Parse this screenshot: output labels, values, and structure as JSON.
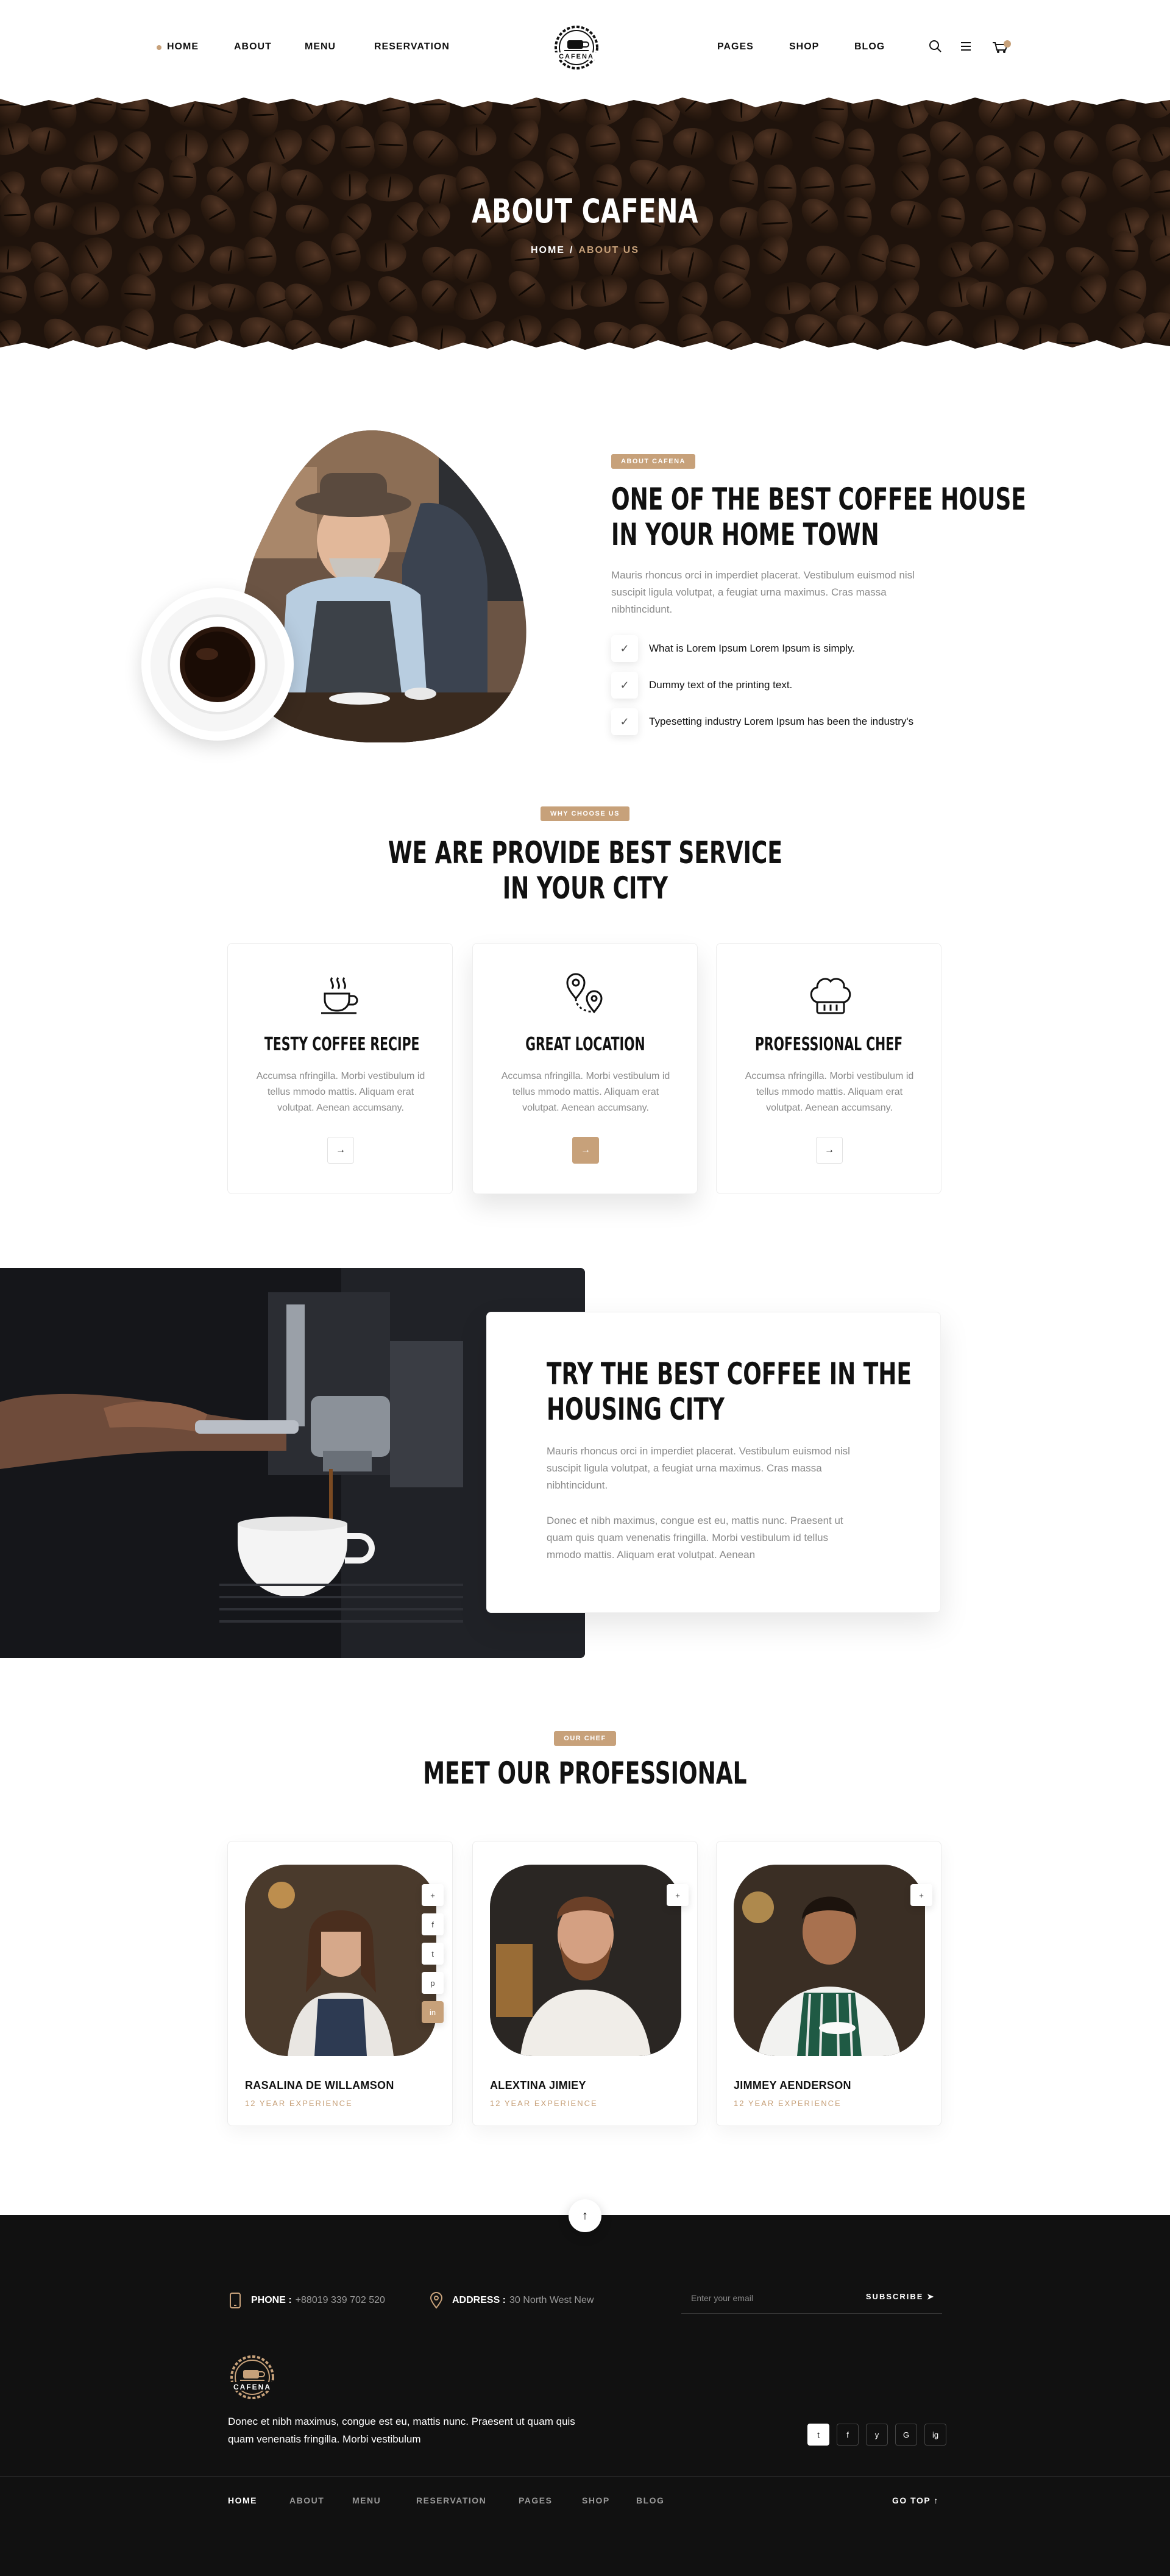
{
  "nav": {
    "left": [
      "HOME",
      "ABOUT",
      "MENU",
      "RESERVATION"
    ],
    "right": [
      "PAGES",
      "SHOP",
      "BLOG"
    ],
    "logo_text": "CAFENA",
    "cart_count": "0",
    "accent": "#c7a17a"
  },
  "hero": {
    "title": "ABOUT CAFENA",
    "crumb_home": "HOME",
    "crumb_sep": "/",
    "crumb_current": "ABOUT US"
  },
  "about": {
    "tag": "ABOUT CAFENA",
    "heading_line1": "ONE OF THE BEST COFFEE HOUSE",
    "heading_line2": "IN YOUR HOME TOWN",
    "paragraph": "Mauris rhoncus orci in imperdiet placerat. Vestibulum euismod nisl suscipit ligula volutpat, a feugiat urna maximus. Cras massa nibhtincidunt.",
    "checks": [
      "What is Lorem Ipsum Lorem Ipsum is simply.",
      "Dummy text of the printing text.",
      "Typesetting industry Lorem Ipsum has been the industry's"
    ]
  },
  "services": {
    "tag": "WHY CHOOSE US",
    "heading_line1": "WE ARE PROVIDE BEST SERVICE",
    "heading_line2": "IN YOUR CITY",
    "cards": [
      {
        "title": "TESTY COFFEE RECIPE",
        "desc": "Accumsa nfringilla. Morbi vestibulum id tellus mmodo mattis. Aliquam erat volutpat. Aenean accumsany.",
        "icon": "coffee-cup-icon",
        "arrow": "→"
      },
      {
        "title": "GREAT LOCATION",
        "desc": "Accumsa nfringilla. Morbi vestibulum id tellus mmodo mattis. Aliquam erat volutpat. Aenean accumsany.",
        "icon": "map-pin-icon",
        "arrow": "→"
      },
      {
        "title": "PROFESSIONAL CHEF",
        "desc": "Accumsa nfringilla. Morbi vestibulum id tellus mmodo mattis. Aliquam erat volutpat. Aenean accumsany.",
        "icon": "chef-hat-icon",
        "arrow": "→"
      }
    ]
  },
  "try": {
    "heading_line1": "TRY THE BEST COFFEE IN THE",
    "heading_line2": "HOUSING CITY",
    "paragraph1": "Mauris rhoncus orci in imperdiet placerat. Vestibulum euismod nisl suscipit ligula volutpat, a feugiat urna maximus. Cras massa nibhtincidunt.",
    "paragraph2": "Donec et nibh maximus, congue est eu, mattis nunc. Praesent ut quam quis quam venenatis fringilla. Morbi vestibulum id tellus mmodo mattis. Aliquam erat volutpat. Aenean"
  },
  "chefs": {
    "tag": "OUR CHEF",
    "heading": "MEET OUR PROFESSIONAL",
    "members": [
      {
        "name": "RASALINA DE WILLAMSON",
        "exp": "12 YEAR EXPERIENCE"
      },
      {
        "name": "ALEXTINA JIMIEY",
        "exp": "12 YEAR EXPERIENCE"
      },
      {
        "name": "JIMMEY AENDERSON",
        "exp": "12 YEAR EXPERIENCE"
      }
    ],
    "share_icons": [
      "+",
      "f",
      "t",
      "p",
      "in"
    ]
  },
  "footer": {
    "phone_label": "PHONE :",
    "phone_value": "+88019 339 702 520",
    "address_label": "ADDRESS :",
    "address_value": "30 North West New",
    "email_placeholder": "Enter your email",
    "subscribe": "SUBSCRIBE",
    "logo_text": "CAFENA",
    "text": "Donec et nibh maximus, congue est eu, mattis nunc. Praesent ut quam quis quam venenatis fringilla. Morbi vestibulum",
    "social": [
      "t",
      "f",
      "y",
      "G",
      "ig"
    ],
    "nav": [
      "HOME",
      "ABOUT",
      "MENU",
      "RESERVATION",
      "PAGES",
      "SHOP",
      "BLOG"
    ],
    "go_top": "GO TOP ↑"
  }
}
